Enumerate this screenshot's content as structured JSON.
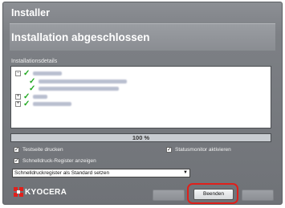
{
  "window": {
    "title": "Installer",
    "heading": "Installation abgeschlossen"
  },
  "details": {
    "label": "Installationsdetails",
    "tree": [
      {
        "expander": "−",
        "checked": true
      },
      {
        "expander": "",
        "checked": true
      },
      {
        "expander": "",
        "checked": true
      },
      {
        "expander": "+",
        "checked": true
      },
      {
        "expander": "+",
        "checked": true
      }
    ]
  },
  "progress": {
    "percent": 100,
    "text": "100 %"
  },
  "options": {
    "testpage_label": "Testseite drucken",
    "testpage_checked": true,
    "statusmonitor_label": "Statusmonitor aktivieren",
    "statusmonitor_checked": true,
    "quickprint_label": "Schnelldruck-Register anzeigen",
    "quickprint_checked": true,
    "select_value": "Schnelldruckregister als Standard setzen"
  },
  "brand": {
    "name": "KYOCERA",
    "color": "#e0201b"
  },
  "buttons": {
    "finish_label": "Beenden"
  },
  "colors": {
    "highlight": "#e0201b",
    "check": "#1fa81f"
  }
}
